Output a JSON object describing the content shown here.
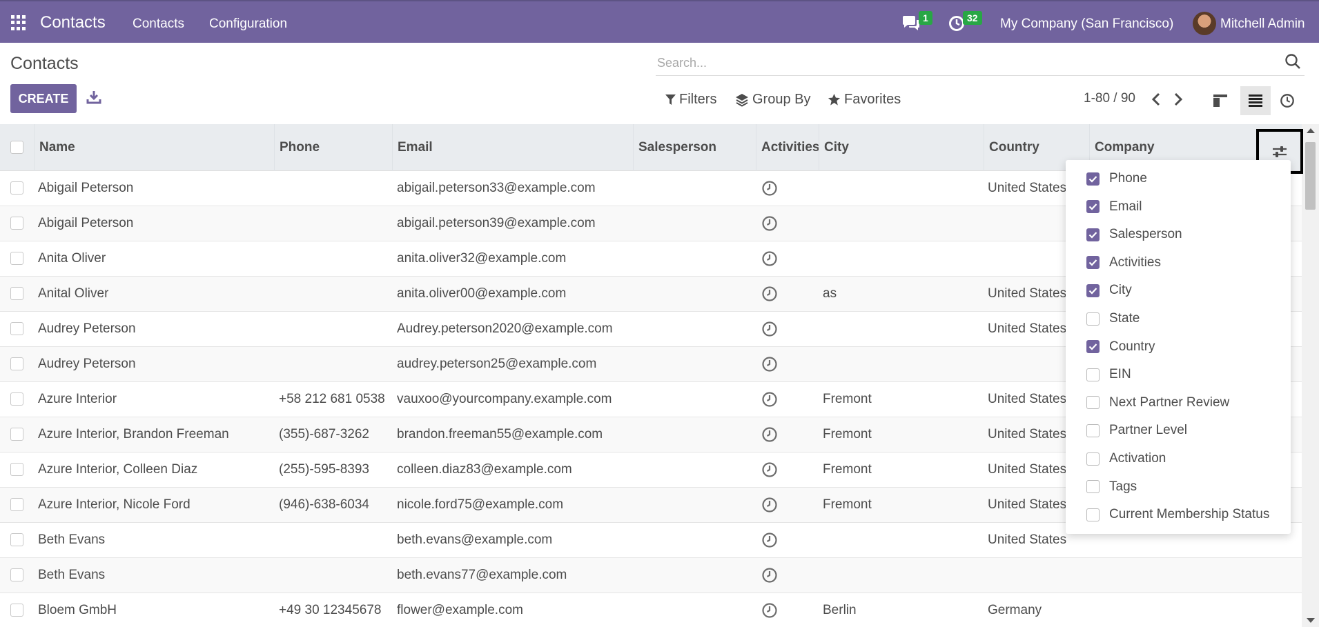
{
  "navbar": {
    "app_name": "Contacts",
    "menu": [
      "Contacts",
      "Configuration"
    ],
    "messages_count": "1",
    "activities_count": "32",
    "company": "My Company (San Francisco)",
    "user": "Mitchell Admin",
    "color": "#71639e"
  },
  "control": {
    "title": "Contacts",
    "create_label": "CREATE",
    "search_placeholder": "Search...",
    "filters_label": "Filters",
    "groupby_label": "Group By",
    "favorites_label": "Favorites",
    "pager": "1-80 / 90"
  },
  "columns": {
    "name": "Name",
    "phone": "Phone",
    "email": "Email",
    "salesperson": "Salesperson",
    "activities": "Activities",
    "city": "City",
    "country": "Country",
    "company": "Company"
  },
  "rows": [
    {
      "name": "Abigail Peterson",
      "phone": "",
      "email": "abigail.peterson33@example.com",
      "city": "",
      "country": "United States"
    },
    {
      "name": "Abigail Peterson",
      "phone": "",
      "email": "abigail.peterson39@example.com",
      "city": "",
      "country": ""
    },
    {
      "name": "Anita Oliver",
      "phone": "",
      "email": "anita.oliver32@example.com",
      "city": "",
      "country": ""
    },
    {
      "name": "Anital Oliver",
      "phone": "",
      "email": "anita.oliver00@example.com",
      "city": "as",
      "country": "United States"
    },
    {
      "name": "Audrey Peterson",
      "phone": "",
      "email": "Audrey.peterson2020@example.com",
      "city": "",
      "country": "United States"
    },
    {
      "name": "Audrey Peterson",
      "phone": "",
      "email": "audrey.peterson25@example.com",
      "city": "",
      "country": ""
    },
    {
      "name": "Azure Interior",
      "phone": "+58 212 681 0538",
      "email": "vauxoo@yourcompany.example.com",
      "city": "Fremont",
      "country": "United States"
    },
    {
      "name": "Azure Interior, Brandon Freeman",
      "phone": "(355)-687-3262",
      "email": "brandon.freeman55@example.com",
      "city": "Fremont",
      "country": "United States"
    },
    {
      "name": "Azure Interior, Colleen Diaz",
      "phone": "(255)-595-8393",
      "email": "colleen.diaz83@example.com",
      "city": "Fremont",
      "country": "United States"
    },
    {
      "name": "Azure Interior, Nicole Ford",
      "phone": "(946)-638-6034",
      "email": "nicole.ford75@example.com",
      "city": "Fremont",
      "country": "United States"
    },
    {
      "name": "Beth Evans",
      "phone": "",
      "email": "beth.evans@example.com",
      "city": "",
      "country": "United States"
    },
    {
      "name": "Beth Evans",
      "phone": "",
      "email": "beth.evans77@example.com",
      "city": "",
      "country": ""
    },
    {
      "name": "Bloem GmbH",
      "phone": "+49 30 12345678",
      "email": "flower@example.com",
      "city": "Berlin",
      "country": "Germany"
    }
  ],
  "optional_columns": [
    {
      "label": "Phone",
      "checked": true
    },
    {
      "label": "Email",
      "checked": true
    },
    {
      "label": "Salesperson",
      "checked": true
    },
    {
      "label": "Activities",
      "checked": true
    },
    {
      "label": "City",
      "checked": true
    },
    {
      "label": "State",
      "checked": false
    },
    {
      "label": "Country",
      "checked": true
    },
    {
      "label": "EIN",
      "checked": false
    },
    {
      "label": "Next Partner Review",
      "checked": false
    },
    {
      "label": "Partner Level",
      "checked": false
    },
    {
      "label": "Activation",
      "checked": false
    },
    {
      "label": "Tags",
      "checked": false
    },
    {
      "label": "Current Membership Status",
      "checked": false
    }
  ]
}
